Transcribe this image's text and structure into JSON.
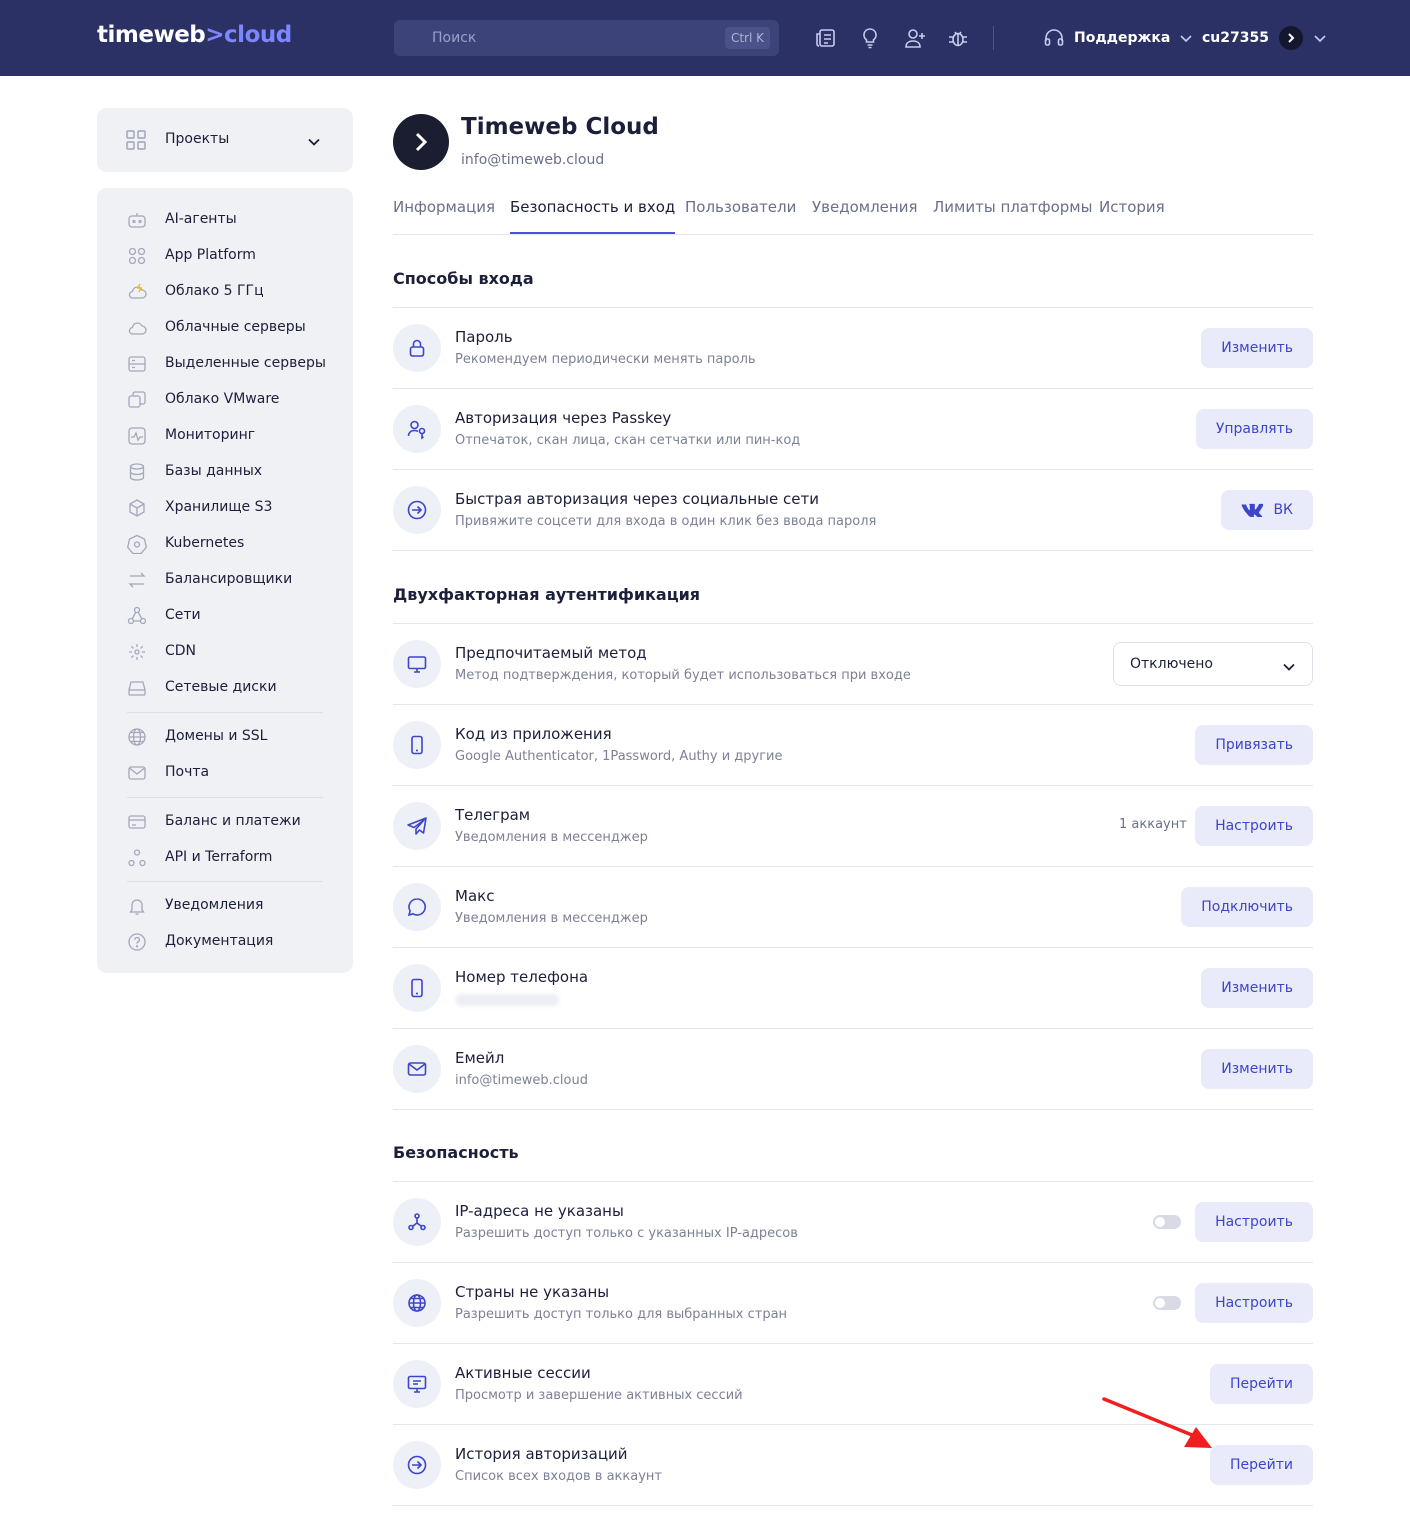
{
  "header": {
    "logo_main": "timeweb",
    "logo_sep": ">",
    "logo_accent": "cloud",
    "search_placeholder": "Поиск",
    "search_shortcut": "Ctrl K",
    "support_label": "Поддержка",
    "account_id": "cu27355"
  },
  "sidebar": {
    "projects_label": "Проекты",
    "items": [
      {
        "label": "AI-агенты",
        "icon": "robot-icon"
      },
      {
        "label": "App Platform",
        "icon": "apps-grid-icon"
      },
      {
        "label": "Облако 5 ГГц",
        "icon": "cloud-bolt-icon"
      },
      {
        "label": "Облачные серверы",
        "icon": "cloud-icon"
      },
      {
        "label": "Выделенные серверы",
        "icon": "server-icon"
      },
      {
        "label": "Облако VMware",
        "icon": "vmware-icon"
      },
      {
        "label": "Мониторинг",
        "icon": "monitoring-icon"
      },
      {
        "label": "Базы данных",
        "icon": "database-icon"
      },
      {
        "label": "Хранилище S3",
        "icon": "cube-icon"
      },
      {
        "label": "Kubernetes",
        "icon": "kubernetes-icon"
      },
      {
        "label": "Балансировщики",
        "icon": "arrows-icon"
      },
      {
        "label": "Сети",
        "icon": "network-icon"
      },
      {
        "label": "CDN",
        "icon": "cdn-icon"
      },
      {
        "label": "Сетевые диски",
        "icon": "disk-icon"
      },
      {
        "label": "Домены и SSL",
        "icon": "globe-icon"
      },
      {
        "label": "Почта",
        "icon": "mail-icon"
      },
      {
        "label": "Баланс и платежи",
        "icon": "card-icon"
      },
      {
        "label": "API и Terraform",
        "icon": "api-icon"
      },
      {
        "label": "Уведомления",
        "icon": "bell-icon"
      },
      {
        "label": "Документация",
        "icon": "help-icon"
      }
    ]
  },
  "org": {
    "name": "Timeweb Cloud",
    "email": "info@timeweb.cloud"
  },
  "tabs": [
    {
      "label": "Информация"
    },
    {
      "label": "Безопасность и вход",
      "active": true
    },
    {
      "label": "Пользователи"
    },
    {
      "label": "Уведомления"
    },
    {
      "label": "Лимиты платформы"
    },
    {
      "label": "История"
    }
  ],
  "sections": {
    "login": {
      "title": "Способы входа",
      "rows": [
        {
          "title": "Пароль",
          "subtitle": "Рекомендуем периодически менять пароль",
          "button": "Изменить"
        },
        {
          "title": "Авторизация через Passkey",
          "subtitle": "Отпечаток, скан лица, скан сетчатки или пин-код",
          "button": "Управлять"
        },
        {
          "title": "Быстрая авторизация через социальные сети",
          "subtitle": "Привяжите соцсети для входа в один клик без ввода пароля",
          "button": "ВК"
        }
      ]
    },
    "twofa": {
      "title": "Двухфакторная аутентификация",
      "rows": [
        {
          "title": "Предпочитаемый метод",
          "subtitle": "Метод подтверждения, который будет использоваться при входе",
          "select_value": "Отключено"
        },
        {
          "title": "Код из приложения",
          "subtitle": "Google Authenticator, 1Password, Authy и другие",
          "button": "Привязать"
        },
        {
          "title": "Телеграм",
          "subtitle": "Уведомления в мессенджер",
          "aux": "1 аккаунт",
          "button": "Настроить"
        },
        {
          "title": "Макс",
          "subtitle": "Уведомления в мессенджер",
          "button": "Подключить"
        },
        {
          "title": "Номер телефона",
          "subtitle": "",
          "button": "Изменить"
        },
        {
          "title": "Емейл",
          "subtitle": "info@timeweb.cloud",
          "button": "Изменить"
        }
      ]
    },
    "security": {
      "title": "Безопасность",
      "rows": [
        {
          "title": "IP-адреса не указаны",
          "subtitle": "Разрешить доступ только с указанных IP-адресов",
          "toggle_on": false,
          "button": "Настроить"
        },
        {
          "title": "Страны не указаны",
          "subtitle": "Разрешить доступ только для выбранных стран",
          "toggle_on": false,
          "button": "Настроить"
        },
        {
          "title": "Активные сессии",
          "subtitle": "Просмотр и завершение активных сессий",
          "button": "Перейти"
        },
        {
          "title": "История авторизаций",
          "subtitle": "Список всех входов в аккаунт",
          "button": "Перейти"
        }
      ]
    }
  },
  "colors": {
    "header_bg": "#2b3164",
    "accent": "#4c52d9",
    "button_bg": "#e9ebfb",
    "annotation_arrow": "#f01e1e"
  }
}
